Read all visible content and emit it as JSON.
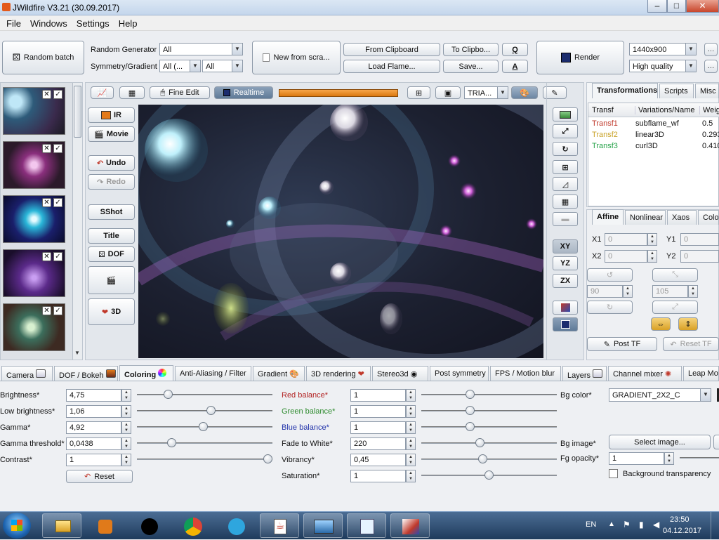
{
  "window": {
    "title": "JWildfire V3.21 (30.09.2017)"
  },
  "menu": [
    "File",
    "Windows",
    "Settings",
    "Help"
  ],
  "toolbar": {
    "random_batch": "Random batch",
    "random_generator_label": "Random Generator",
    "random_generator_value": "All",
    "symmetry_label": "Symmetry/Gradient",
    "symmetry_value": "All (...",
    "gradient_value": "All",
    "new_from_scratch": "New from scra...",
    "from_clipboard": "From Clipboard",
    "load_flame": "Load Flame...",
    "to_clipboard": "To Clipbo...",
    "save": "Save...",
    "q": "Q",
    "a": "A",
    "render": "Render",
    "resolution": "1440x900",
    "quality": "High quality"
  },
  "preview_toolbar": {
    "fine_edit": "Fine Edit",
    "realtime": "Realtime",
    "triangle_mode": "TRIA..."
  },
  "left_tools": {
    "ir": "IR",
    "movie": "Movie",
    "undo": "Undo",
    "redo": "Redo",
    "sshot": "SShot",
    "title": "Title",
    "dof": "DOF",
    "threed": "3D"
  },
  "right_tools": {
    "xy": "XY",
    "yz": "YZ",
    "zx": "ZX"
  },
  "right_panel": {
    "tabs": [
      "Transformations",
      "Scripts",
      "Misc"
    ],
    "columns": [
      "Transf",
      "Variations/Name",
      "Weig"
    ],
    "rows": [
      {
        "name": "Transf1",
        "variation": "subflame_wf",
        "weight": "0.5",
        "color": "#c0392b"
      },
      {
        "name": "Transf2",
        "variation": "linear3D",
        "weight": "0.293",
        "color": "#c9a227"
      },
      {
        "name": "Transf3",
        "variation": "curl3D",
        "weight": "0.410",
        "color": "#27a34a"
      }
    ],
    "subtabs": [
      "Affine",
      "Nonlinear",
      "Xaos",
      "Color"
    ],
    "x1_label": "X1",
    "x1_value": "0",
    "y1_label": "Y1",
    "y1_value": "0",
    "x2_label": "X2",
    "x2_value": "0",
    "y2_label": "Y2",
    "y2_value": "0",
    "rotate_value": "90",
    "scale_value": "105",
    "post_tf": "Post TF",
    "reset_tf": "Reset TF"
  },
  "bottom_tabs": [
    "Camera",
    "DOF / Bokeh",
    "Coloring",
    "Anti-Aliasing / Filter",
    "Gradient",
    "3D rendering",
    "Stereo3d",
    "Post symmetry",
    "FPS / Motion blur",
    "Layers",
    "Channel mixer",
    "Leap Mot"
  ],
  "coloring": {
    "brightness_label": "Brightness*",
    "brightness": "4,75",
    "brightness_level": 0.21,
    "low_brightness_label": "Low brightness*",
    "low_brightness": "1,06",
    "low_brightness_level": 0.55,
    "gamma_label": "Gamma*",
    "gamma": "4,92",
    "gamma_level": 0.49,
    "gamma_threshold_label": "Gamma threshold*",
    "gamma_threshold": "0,0438",
    "gamma_threshold_level": 0.24,
    "contrast_label": "Contrast*",
    "contrast": "1",
    "contrast_level": 1.0,
    "reset": "Reset",
    "red_balance_label": "Red balance*",
    "red_balance": "1",
    "red_level": 0.35,
    "green_balance_label": "Green balance*",
    "green_balance": "1",
    "green_level": 0.35,
    "blue_balance_label": "Blue balance*",
    "blue_balance": "1",
    "blue_level": 0.35,
    "fade_label": "Fade to White*",
    "fade": "220",
    "fade_level": 0.43,
    "vibrancy_label": "Vibrancy*",
    "vibrancy": "0,45",
    "vibrancy_level": 0.45,
    "saturation_label": "Saturation*",
    "saturation": "1",
    "saturation_level": 0.5,
    "bg_color_label": "Bg color*",
    "bg_color_value": "GRADIENT_2X2_C",
    "bg_image_label": "Bg image*",
    "select_image": "Select image...",
    "fg_opacity_label": "Fg opacity*",
    "fg_opacity": "1",
    "bg_transparency": "Background transparency"
  },
  "taskbar": {
    "language": "EN",
    "time": "23:50",
    "date": "04.12.2017"
  },
  "colors": {
    "accent": "#d9770f",
    "red_label": "#b22222",
    "green_label": "#2e8b2e",
    "blue_label": "#2233aa"
  }
}
